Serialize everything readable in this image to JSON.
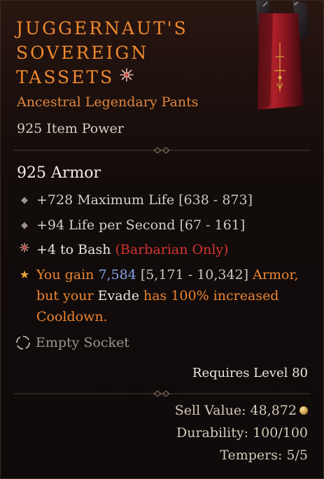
{
  "item": {
    "title_lines": [
      "JUGGERNAUT'S",
      "SOVEREIGN",
      "TASSETS"
    ],
    "type": "Ancestral Legendary Pants",
    "item_power": "925 Item Power",
    "armor": "925 Armor"
  },
  "affixes": [
    {
      "text": "+728 Maximum Life",
      "range": "[638 - 873]",
      "icon": "diamond-bullet-icon"
    },
    {
      "text": "+94 Life per Second",
      "range": "[67 - 161]",
      "icon": "diamond-bullet-icon"
    },
    {
      "text": "+4 to Bash",
      "restriction": "(Barbarian Only)",
      "icon": "sparkle-bullet-icon"
    }
  ],
  "legendary": {
    "icon": "star-icon",
    "prefix": "You gain ",
    "value": "7,584",
    "range": " [5,171 - 10,342] ",
    "suffix1": "Armor,",
    "mid": "but your ",
    "skill": "Evade",
    "suffix2": " has 100% increased",
    "line3": "Cooldown."
  },
  "socket": {
    "label": "Empty Socket",
    "icon": "socket-ring-icon"
  },
  "requirements": "Requires Level 80",
  "stats": {
    "sell_value": "Sell Value: 48,872",
    "durability": "Durability: 100/100",
    "tempers": "Tempers: 5/5"
  },
  "colors": {
    "legendary_orange": "#ee8530",
    "restriction_red": "#d8342e",
    "value_blue": "#86a4ea",
    "background": "#120c0b"
  }
}
